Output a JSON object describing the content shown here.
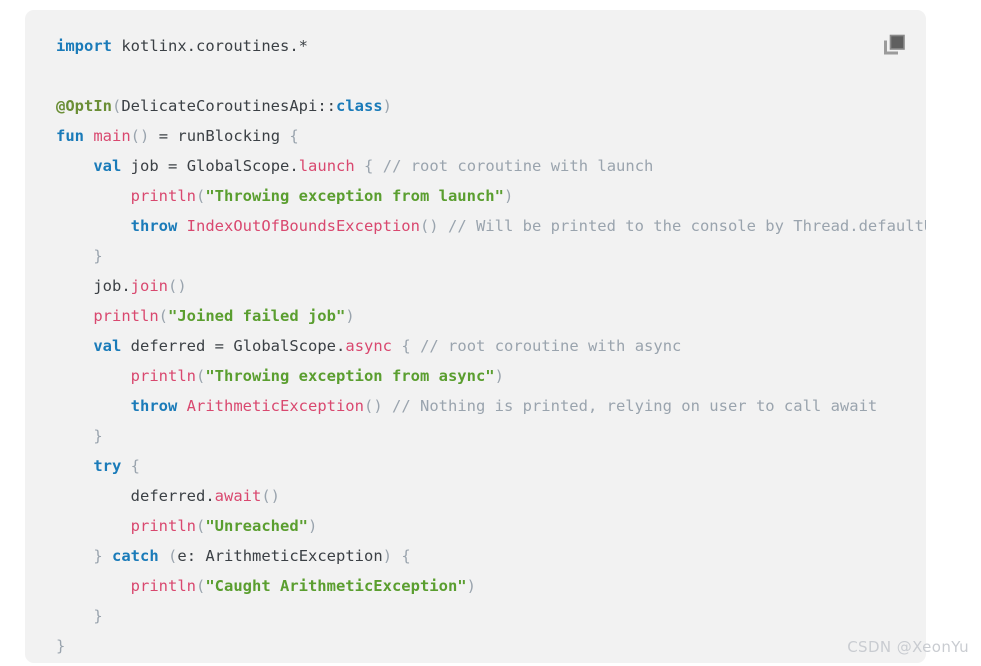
{
  "card": {
    "background_color": "#f2f2f2",
    "language": "kotlin",
    "copy_button": {
      "icon": "copy-icon",
      "label": "Copy"
    }
  },
  "watermark": {
    "text": "CSDN @XeonYu"
  },
  "colors": {
    "keyword": "#1a7bb9",
    "annotation": "#6a8e35",
    "function": "#d9486f",
    "string": "#5a9e2f",
    "comment": "#9aa4ae",
    "punctuation": "#9aa4ae",
    "identifier": "#3b4045",
    "card_background": "#f2f2f2",
    "page_background": "#ffffff",
    "watermark": "#c9ccd1"
  },
  "code": {
    "lines": [
      "import kotlinx.coroutines.*",
      "",
      "@OptIn(DelicateCoroutinesApi::class)",
      "fun main() = runBlocking {",
      "    val job = GlobalScope.launch { // root coroutine with launch",
      "        println(\"Throwing exception from launch\")",
      "        throw IndexOutOfBoundsException() // Will be printed to the console by Thread.defaultUncaughtExceptionHandler",
      "    }",
      "    job.join()",
      "    println(\"Joined failed job\")",
      "    val deferred = GlobalScope.async { // root coroutine with async",
      "        println(\"Throwing exception from async\")",
      "        throw ArithmeticException() // Nothing is printed, relying on user to call await",
      "    }",
      "    try {",
      "        deferred.await()",
      "        println(\"Unreached\")",
      "    } catch (e: ArithmeticException) {",
      "        println(\"Caught ArithmeticException\")",
      "    }",
      "}"
    ],
    "strings": [
      "\"Throwing exception from launch\"",
      "\"Joined failed job\"",
      "\"Throwing exception from async\"",
      "\"Unreached\"",
      "\"Caught ArithmeticException\""
    ],
    "comments": [
      "// root coroutine with launch",
      "// Will be printed to the console by Thread.defaultUncaughtExceptionHandler",
      "// root coroutine with async",
      "// Nothing is printed, relying on user to call await"
    ],
    "keywords": [
      "import",
      "fun",
      "val",
      "throw",
      "try",
      "catch",
      "class"
    ],
    "functions": [
      "main",
      "runBlocking",
      "launch",
      "println",
      "join",
      "async",
      "await"
    ],
    "annotations": [
      "@OptIn"
    ],
    "types": [
      "IndexOutOfBoundsException",
      "ArithmeticException",
      "DelicateCoroutinesApi",
      "GlobalScope"
    ]
  }
}
